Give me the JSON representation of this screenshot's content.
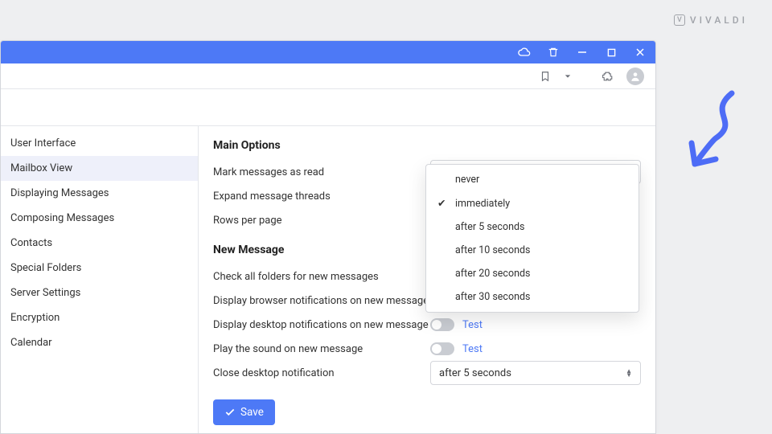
{
  "brand": "VIVALDI",
  "sidebar": {
    "items": [
      {
        "label": "User Interface"
      },
      {
        "label": "Mailbox View",
        "active": true
      },
      {
        "label": "Displaying Messages"
      },
      {
        "label": "Composing Messages"
      },
      {
        "label": "Contacts"
      },
      {
        "label": "Special Folders"
      },
      {
        "label": "Server Settings"
      },
      {
        "label": "Encryption"
      },
      {
        "label": "Calendar"
      }
    ]
  },
  "sections": {
    "main": {
      "title": "Main Options",
      "mark_read_label": "Mark messages as read",
      "mark_read_value": "immediately",
      "mark_read_options": [
        "never",
        "immediately",
        "after 5 seconds",
        "after 10 seconds",
        "after 20 seconds",
        "after 30 seconds"
      ],
      "expand_threads_label": "Expand message threads",
      "rows_per_page_label": "Rows per page"
    },
    "newmsg": {
      "title": "New Message",
      "check_all_label": "Check all folders for new messages",
      "browser_notif_label": "Display browser notifications on new message",
      "desktop_notif_label": "Display desktop notifications on new message",
      "play_sound_label": "Play the sound on new message",
      "close_notif_label": "Close desktop notification",
      "close_notif_value": "after 5 seconds",
      "test_label": "Test"
    }
  },
  "buttons": {
    "save": "Save"
  }
}
